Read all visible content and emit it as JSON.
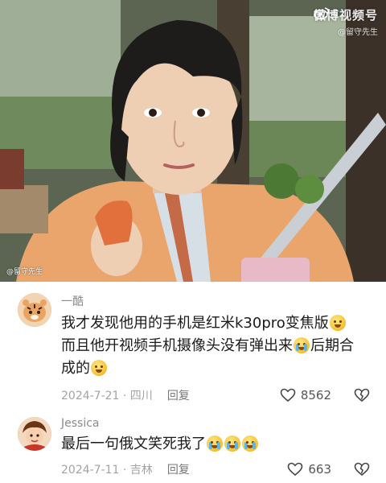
{
  "watermark": {
    "platform": "微博视频号",
    "account": "@留守先生",
    "bottom_tag": "@留守先生"
  },
  "comments": [
    {
      "username": "一酷",
      "segments": [
        "我才发现他用的手机是红米k30pro变焦版",
        "而且他开视频手机摄像头没有弹出来",
        "后期合成的"
      ],
      "date_location": "2024-7-21 · 四川",
      "reply_label": "回复",
      "likes": "8562",
      "emoji_after_segments": [
        "worried-face",
        "crying-face",
        "worried-face"
      ]
    },
    {
      "username": "Jessica",
      "segments": [
        "最后一句俄文笑死我了"
      ],
      "date_location": "2024-7-11 · 吉林",
      "reply_label": "回复",
      "likes": "663",
      "emoji_after_segments": [
        "loudly-crying-face ×3"
      ]
    }
  ],
  "colors": {
    "username": "#8a8a8a",
    "meta": "#a3a3a3",
    "text": "#1b1b1b"
  }
}
